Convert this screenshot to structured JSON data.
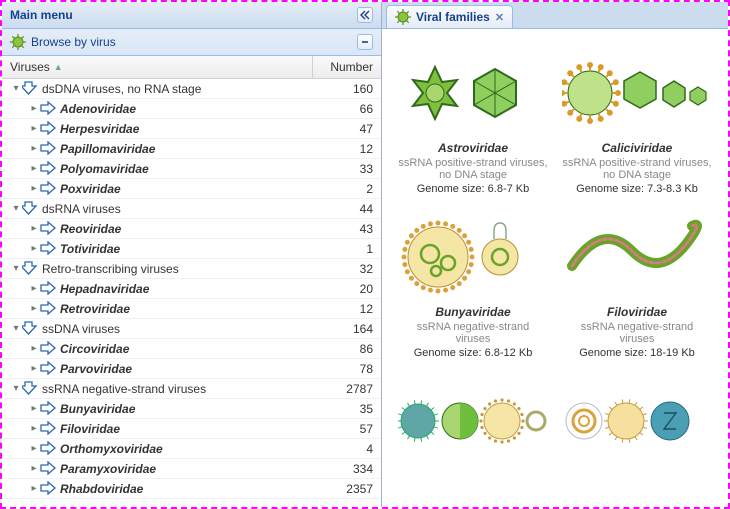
{
  "left": {
    "mainMenuTitle": "Main menu",
    "subTitle": "Browse by virus",
    "colVirus": "Viruses",
    "colNumber": "Number"
  },
  "tree": [
    {
      "level": 0,
      "expanded": true,
      "kind": "group",
      "label": "dsDNA viruses, no RNA stage",
      "num": 160
    },
    {
      "level": 1,
      "expanded": false,
      "kind": "family",
      "label": "Adenoviridae",
      "num": 66
    },
    {
      "level": 1,
      "expanded": false,
      "kind": "family",
      "label": "Herpesviridae",
      "num": 47
    },
    {
      "level": 1,
      "expanded": false,
      "kind": "family",
      "label": "Papillomaviridae",
      "num": 12
    },
    {
      "level": 1,
      "expanded": false,
      "kind": "family",
      "label": "Polyomaviridae",
      "num": 33
    },
    {
      "level": 1,
      "expanded": false,
      "kind": "family",
      "label": "Poxviridae",
      "num": 2
    },
    {
      "level": 0,
      "expanded": true,
      "kind": "group",
      "label": "dsRNA viruses",
      "num": 44
    },
    {
      "level": 1,
      "expanded": false,
      "kind": "family",
      "label": "Reoviridae",
      "num": 43
    },
    {
      "level": 1,
      "expanded": false,
      "kind": "family",
      "label": "Totiviridae",
      "num": 1
    },
    {
      "level": 0,
      "expanded": true,
      "kind": "group",
      "label": "Retro-transcribing viruses",
      "num": 32
    },
    {
      "level": 1,
      "expanded": false,
      "kind": "family",
      "label": "Hepadnaviridae",
      "num": 20
    },
    {
      "level": 1,
      "expanded": false,
      "kind": "family",
      "label": "Retroviridae",
      "num": 12
    },
    {
      "level": 0,
      "expanded": true,
      "kind": "group",
      "label": "ssDNA viruses",
      "num": 164
    },
    {
      "level": 1,
      "expanded": false,
      "kind": "family",
      "label": "Circoviridae",
      "num": 86
    },
    {
      "level": 1,
      "expanded": false,
      "kind": "family",
      "label": "Parvoviridae",
      "num": 78
    },
    {
      "level": 0,
      "expanded": true,
      "kind": "group",
      "label": "ssRNA negative-strand viruses",
      "num": 2787
    },
    {
      "level": 1,
      "expanded": false,
      "kind": "family",
      "label": "Bunyaviridae",
      "num": 35
    },
    {
      "level": 1,
      "expanded": false,
      "kind": "family",
      "label": "Filoviridae",
      "num": 57
    },
    {
      "level": 1,
      "expanded": false,
      "kind": "family",
      "label": "Orthomyxoviridae",
      "num": 4
    },
    {
      "level": 1,
      "expanded": false,
      "kind": "family",
      "label": "Paramyxoviridae",
      "num": 334
    },
    {
      "level": 1,
      "expanded": false,
      "kind": "family",
      "label": "Rhabdoviridae",
      "num": 2357
    }
  ],
  "tab": {
    "label": "Viral families"
  },
  "cards": [
    {
      "title": "Astroviridae",
      "sub": "ssRNA positive-strand viruses, no DNA stage",
      "size": "Genome size: 6.8-7 Kb",
      "svg": "astro"
    },
    {
      "title": "Caliciviridae",
      "sub": "ssRNA positive-strand viruses, no DNA stage",
      "size": "Genome size: 7.3-8.3 Kb",
      "svg": "calici"
    },
    {
      "title": "Bunyaviridae",
      "sub": "ssRNA negative-strand viruses",
      "size": "Genome size: 6.8-12 Kb",
      "svg": "bunya"
    },
    {
      "title": "Filoviridae",
      "sub": "ssRNA negative-strand viruses",
      "size": "Genome size: 18-19 Kb",
      "svg": "filo"
    },
    {
      "title": "",
      "sub": "",
      "size": "",
      "svg": "assort1"
    },
    {
      "title": "",
      "sub": "",
      "size": "",
      "svg": "assort2"
    }
  ]
}
